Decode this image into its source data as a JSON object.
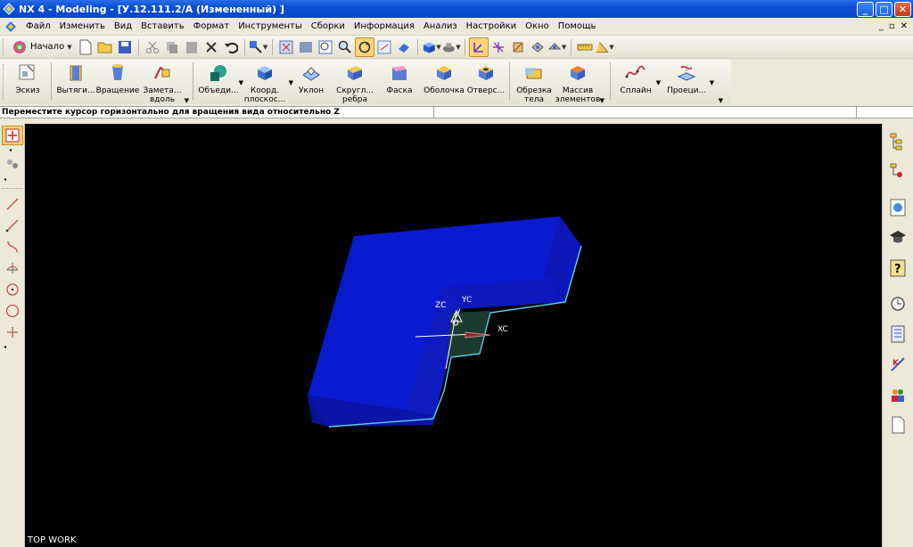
{
  "window": {
    "title": "NX 4 - Modeling - [У.12.111.2/А (Измененный) ]",
    "controls": {
      "minimize": "_",
      "maximize": "□",
      "close": "✕"
    }
  },
  "menubar": {
    "items": [
      {
        "label": "Файл"
      },
      {
        "label": "Изменить"
      },
      {
        "label": "Вид"
      },
      {
        "label": "Вставить"
      },
      {
        "label": "Формат"
      },
      {
        "label": "Инструменты"
      },
      {
        "label": "Сборки"
      },
      {
        "label": "Информация"
      },
      {
        "label": "Анализ"
      },
      {
        "label": "Настройки"
      },
      {
        "label": "Окно"
      },
      {
        "label": "Помощь"
      }
    ],
    "mdi": {
      "minimize": "_",
      "restore": "▫",
      "close": "✕"
    }
  },
  "toolbar": {
    "start_label": "Начало"
  },
  "features": [
    {
      "label": "Эскиз",
      "icon": "sketch-icon"
    },
    {
      "label": "Вытяги...",
      "icon": "extrude-icon"
    },
    {
      "label": "Вращение",
      "icon": "revolve-icon"
    },
    {
      "label": "Замета... вдоль",
      "icon": "sweep-icon"
    },
    {
      "label": "Объеди...",
      "icon": "unite-icon"
    },
    {
      "label": "Коорд. плоскос...",
      "icon": "datum-plane-icon"
    },
    {
      "label": "Уклон",
      "icon": "draft-icon"
    },
    {
      "label": "Скругл... ребра",
      "icon": "edge-blend-icon"
    },
    {
      "label": "Фаска",
      "icon": "chamfer-icon"
    },
    {
      "label": "Оболочка",
      "icon": "shell-icon"
    },
    {
      "label": "Отверс...",
      "icon": "hole-icon"
    },
    {
      "label": "Обрезка тела",
      "icon": "trim-body-icon"
    },
    {
      "label": "Массив элементов",
      "icon": "pattern-icon"
    },
    {
      "label": "Сплайн",
      "icon": "spline-icon"
    },
    {
      "label": "Проеци...",
      "icon": "project-curve-icon"
    }
  ],
  "status": {
    "message": "Переместите курсор горизонтально для вращения вида относительно Z"
  },
  "viewport": {
    "view_name": "TOP WORK",
    "axes": {
      "x": "XC",
      "y": "YC",
      "z": "ZC"
    },
    "colors": {
      "background": "#000000",
      "solid": "#0c17c8",
      "edge": "#58d6e6",
      "face_dark": "#1c2e6a"
    }
  }
}
